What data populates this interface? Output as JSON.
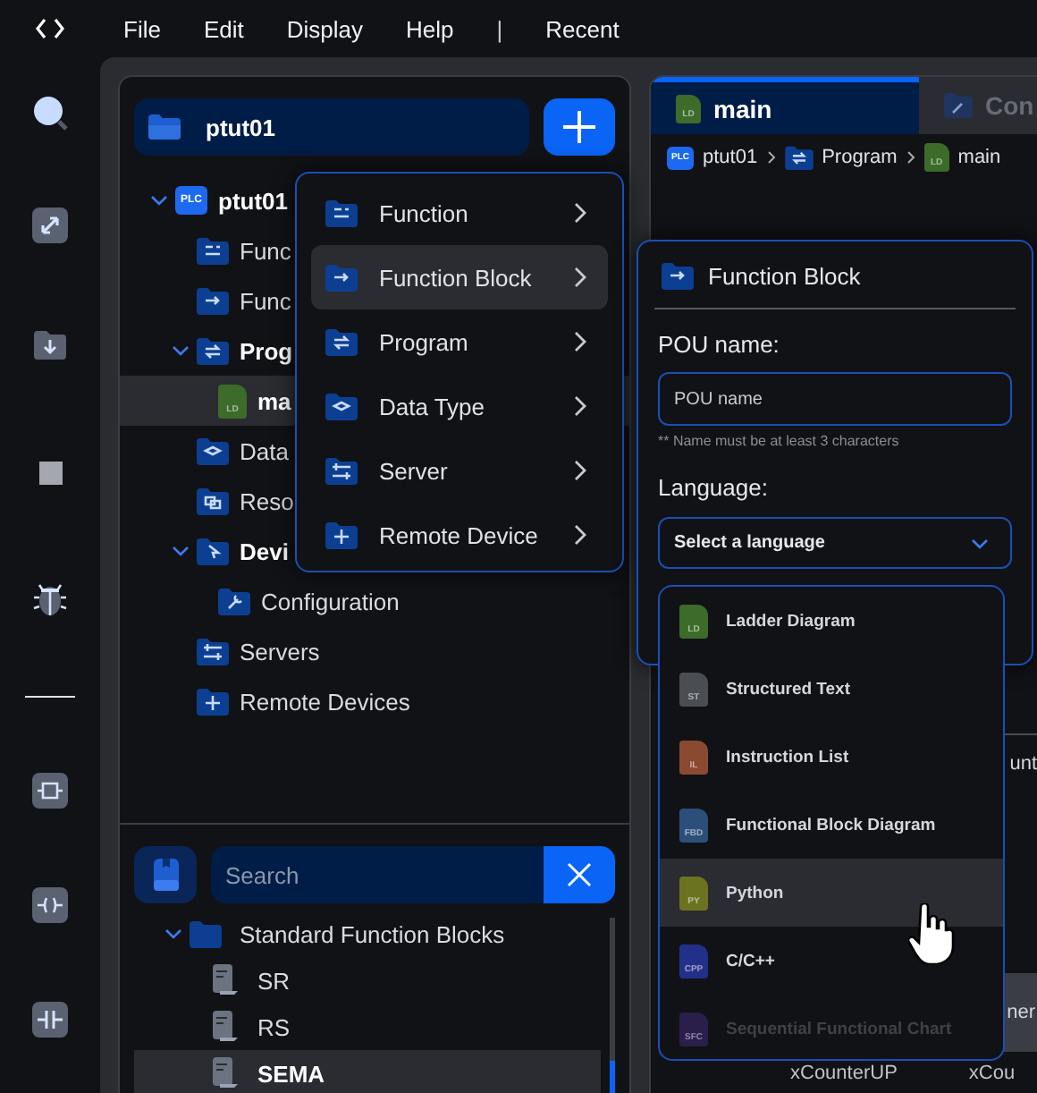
{
  "menu_bar": {
    "items": [
      "File",
      "Edit",
      "Display",
      "Help",
      "|",
      "Recent"
    ]
  },
  "project": {
    "name": "ptut01"
  },
  "tree": [
    {
      "label": "ptut01",
      "kind": "plc",
      "tag": "PLC",
      "expanded": true,
      "selected": false,
      "children": [
        {
          "label": "Func",
          "kind": "function",
          "selected": false
        },
        {
          "label": "Func",
          "kind": "function-block",
          "selected": false
        },
        {
          "label": "Prog",
          "kind": "program",
          "expanded": true,
          "selected": false,
          "children": [
            {
              "label": "ma",
              "kind": "file",
              "tag": "LD",
              "color": "#3d6b2a",
              "selected": true
            }
          ]
        },
        {
          "label": "Data",
          "kind": "data-type",
          "selected": false
        },
        {
          "label": "Reso",
          "kind": "resource",
          "selected": false
        },
        {
          "label": "Devi",
          "kind": "device",
          "expanded": true,
          "selected": false,
          "children": [
            {
              "label": "Configuration",
              "kind": "config",
              "selected": false
            }
          ]
        },
        {
          "label": "Servers",
          "kind": "server",
          "selected": false
        },
        {
          "label": "Remote Devices",
          "kind": "remote",
          "selected": false
        }
      ]
    }
  ],
  "library": {
    "search": {
      "placeholder": "Search"
    },
    "tree": [
      {
        "label": "Standard Function Blocks",
        "expanded": true,
        "selected": false,
        "children": [
          {
            "label": "SR",
            "selected": false
          },
          {
            "label": "RS",
            "selected": false
          },
          {
            "label": "SEMA",
            "selected": true
          }
        ]
      }
    ]
  },
  "context_menu": [
    {
      "label": "Function",
      "kind": "function",
      "highlighted": false
    },
    {
      "label": "Function Block",
      "kind": "function-block",
      "highlighted": true
    },
    {
      "label": "Program",
      "kind": "program",
      "highlighted": false
    },
    {
      "label": "Data Type",
      "kind": "data-type",
      "highlighted": false
    },
    {
      "label": "Server",
      "kind": "server",
      "highlighted": false
    },
    {
      "label": "Remote Device",
      "kind": "remote",
      "highlighted": false
    }
  ],
  "tabs": [
    {
      "label": "main",
      "kind": "file",
      "tag": "LD",
      "color": "#3d6b2a",
      "selected": true
    },
    {
      "label": "Con",
      "kind": "config",
      "selected": false
    }
  ],
  "breadcrumb": [
    {
      "label": "ptut01",
      "kind": "plc",
      "tag": "PLC"
    },
    {
      "label": "Program",
      "kind": "program"
    },
    {
      "label": "main",
      "kind": "file",
      "tag": "LD",
      "color": "#3d6b2a"
    }
  ],
  "dialog": {
    "title": "Function Block",
    "name_label": "POU name:",
    "name_placeholder": "POU name",
    "hint": "** Name must be at least 3 characters",
    "language_label": "Language:",
    "language_placeholder": "Select a language"
  },
  "languages": [
    {
      "label": "Ladder Diagram",
      "tag": "LD",
      "color": "#3d6b2a",
      "highlighted": false,
      "disabled": false
    },
    {
      "label": "Structured Text",
      "tag": "ST",
      "color": "#4a4d52",
      "highlighted": false,
      "disabled": false
    },
    {
      "label": "Instruction List",
      "tag": "IL",
      "color": "#8a4a32",
      "highlighted": false,
      "disabled": false
    },
    {
      "label": "Functional Block Diagram",
      "tag": "FBD",
      "color": "#2c4f7a",
      "highlighted": false,
      "disabled": false
    },
    {
      "label": "Python",
      "tag": "PY",
      "color": "#6b7320",
      "highlighted": true,
      "disabled": false
    },
    {
      "label": "C/C++",
      "tag": "CPP",
      "color": "#22308a",
      "highlighted": false,
      "disabled": false
    },
    {
      "label": "Sequential Functional Chart",
      "tag": "SFC",
      "color": "#2a1f4a",
      "highlighted": false,
      "disabled": true
    }
  ],
  "editor_background": {
    "cells": [
      "unt",
      "ner",
      "xCounterUP",
      "xCou"
    ]
  }
}
